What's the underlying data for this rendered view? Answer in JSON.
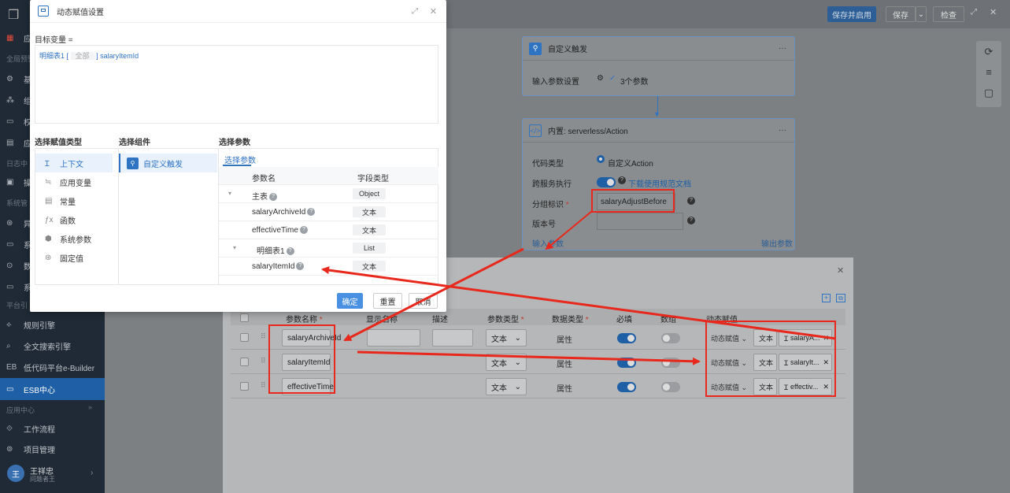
{
  "nav": {
    "items": [
      {
        "label": "应",
        "icon": "grid-icon"
      },
      {
        "label": "全局预警",
        "icon": ""
      },
      {
        "label": "基",
        "icon": "gear-icon"
      },
      {
        "label": "组",
        "icon": "org-icon"
      },
      {
        "label": "权",
        "icon": "permission-icon"
      },
      {
        "label": "应",
        "icon": "apps-icon"
      },
      {
        "label": "日志中",
        "icon": ""
      },
      {
        "label": "操",
        "icon": "log-icon"
      },
      {
        "label": "系统管",
        "icon": ""
      },
      {
        "label": "异",
        "icon": "warning-icon"
      },
      {
        "label": "系",
        "icon": "system-icon"
      },
      {
        "label": "数",
        "icon": "data-icon"
      },
      {
        "label": "系",
        "icon": "monitor-icon"
      },
      {
        "label": "平台引",
        "icon": ""
      }
    ],
    "rule_engine": "规则引擎",
    "fulltext": "全文搜索引擎",
    "lowcode": "低代码平台e-Builder",
    "esb": "ESB中心",
    "app_center": "应用中心",
    "workflow": "工作流程",
    "project": "项目管理",
    "user_name": "王祥忠",
    "user_sub": "问题者王",
    "avatar_letter": "王"
  },
  "topbar": {
    "save_publish": "保存并启用",
    "save": "保存",
    "check": "检查"
  },
  "flow": {
    "node1_title": "自定义触发",
    "node1_row_label": "输入参数设置",
    "node1_row_value": "3个参数",
    "node2_title": "内置: serverless/Action",
    "code_type_label": "代码类型",
    "code_type_value": "自定义Action",
    "cross_service_label": "跨服务执行",
    "cross_service_link": "下载使用规范文档",
    "group_id_label": "分组标识",
    "group_id_value": "salaryAdjustBefore",
    "version_label": "版本号",
    "input_params": "输入参数",
    "output_params": "输出参数",
    "more": "···"
  },
  "lowdlg": {
    "headers": {
      "name": "参数名称",
      "display": "显示名称",
      "desc": "描述",
      "ptype": "参数类型",
      "dtype": "数据类型",
      "required": "必填",
      "array": "数组",
      "dyn": "动态赋值"
    },
    "rows": [
      {
        "name": "salaryArchiveId",
        "ptype": "文本",
        "dtype": "属性",
        "required": true,
        "array": false,
        "dyn": "动态赋值",
        "tag": "文本",
        "value": "salaryA..."
      },
      {
        "name": "salaryItemId",
        "ptype": "文本",
        "dtype": "属性",
        "required": true,
        "array": false,
        "dyn": "动态赋值",
        "tag": "文本",
        "value": "salaryIt..."
      },
      {
        "name": "effectiveTime",
        "ptype": "文本",
        "dtype": "属性",
        "required": true,
        "array": false,
        "dyn": "动态赋值",
        "tag": "文本",
        "value": "effectiv..."
      }
    ]
  },
  "modal": {
    "title": "动态赋值设置",
    "target_label": "目标变量 =",
    "expr_prefix": "明细表1 [",
    "expr_all": "全部",
    "expr_suffix": "] salaryItemId",
    "col_type": "选择赋值类型",
    "col_comp": "选择组件",
    "col_param": "选择参数",
    "types": [
      "上下文",
      "应用变量",
      "常量",
      "函数",
      "系统参数",
      "固定值"
    ],
    "component": "自定义触发",
    "param_tab": "选择参数",
    "param_headers": {
      "name": "参数名",
      "type": "字段类型"
    },
    "params": [
      {
        "name": "主表",
        "type": "Object",
        "expand": true,
        "indent": 0
      },
      {
        "name": "salaryArchiveId",
        "type": "文本",
        "expand": false,
        "indent": 1
      },
      {
        "name": "effectiveTime",
        "type": "文本",
        "expand": false,
        "indent": 1
      },
      {
        "name": "明细表1",
        "type": "List",
        "expand": true,
        "indent": 0
      },
      {
        "name": "salaryItemId",
        "type": "文本",
        "expand": false,
        "indent": 1
      }
    ],
    "btn_ok": "确定",
    "btn_reset": "重置",
    "btn_cancel": "取消"
  },
  "colors": {
    "accent": "#2f73c3",
    "annotation": "#e8281c",
    "nav_bg": "#1f2a36"
  }
}
